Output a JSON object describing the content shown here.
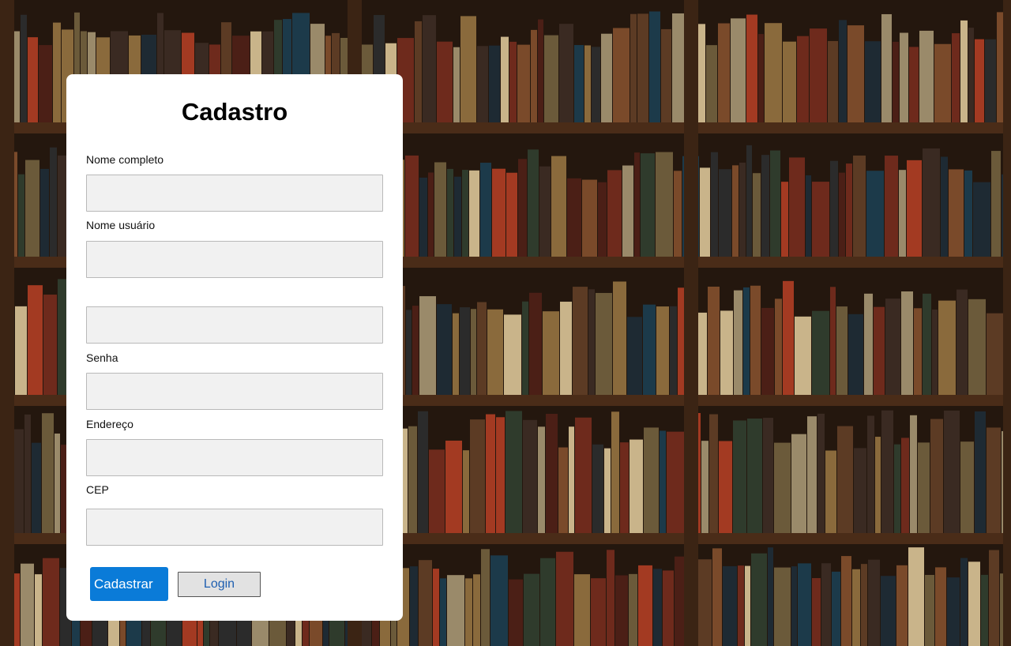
{
  "form": {
    "title": "Cadastro",
    "fields": [
      {
        "label": "Nome completo",
        "value": "",
        "placeholder": ""
      },
      {
        "label": "Nome usuário",
        "value": "",
        "placeholder": ""
      },
      {
        "label": "",
        "value": "",
        "placeholder": ""
      },
      {
        "label": "Senha",
        "value": "",
        "placeholder": ""
      },
      {
        "label": "Endereço",
        "value": "",
        "placeholder": ""
      },
      {
        "label": "CEP",
        "value": "",
        "placeholder": ""
      }
    ],
    "submit_label": "Cadastrar",
    "login_label": "Login"
  },
  "colors": {
    "primary_button": "#0a7bd8",
    "card_background": "#ffffff",
    "field_background": "#f1f1f1"
  }
}
